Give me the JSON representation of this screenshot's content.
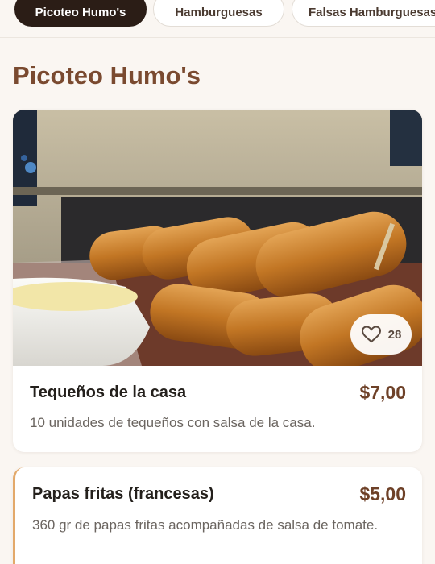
{
  "tabs": [
    {
      "label": "Picoteo Humo's",
      "active": true
    },
    {
      "label": "Hamburguesas",
      "active": false
    },
    {
      "label": "Falsas Hamburguesas",
      "active": false
    }
  ],
  "section": {
    "title": "Picoteo Humo's"
  },
  "products": [
    {
      "name": "Tequeños de la casa",
      "price": "$7,00",
      "description": "10 unidades de tequeños con salsa de la casa.",
      "likes": "28",
      "image_icon": "fried-cheese-sticks-photo",
      "like_icon": "heart-icon"
    },
    {
      "name": "Papas fritas (francesas)",
      "price": "$5,00",
      "description": "360 gr de papas fritas acompañadas de salsa de tomate."
    }
  ],
  "colors": {
    "background": "#faf6f2",
    "active_tab": "#2b1d16",
    "section_title": "#7a4a30",
    "price": "#6e4128",
    "card_accent": "#e3a96a"
  }
}
